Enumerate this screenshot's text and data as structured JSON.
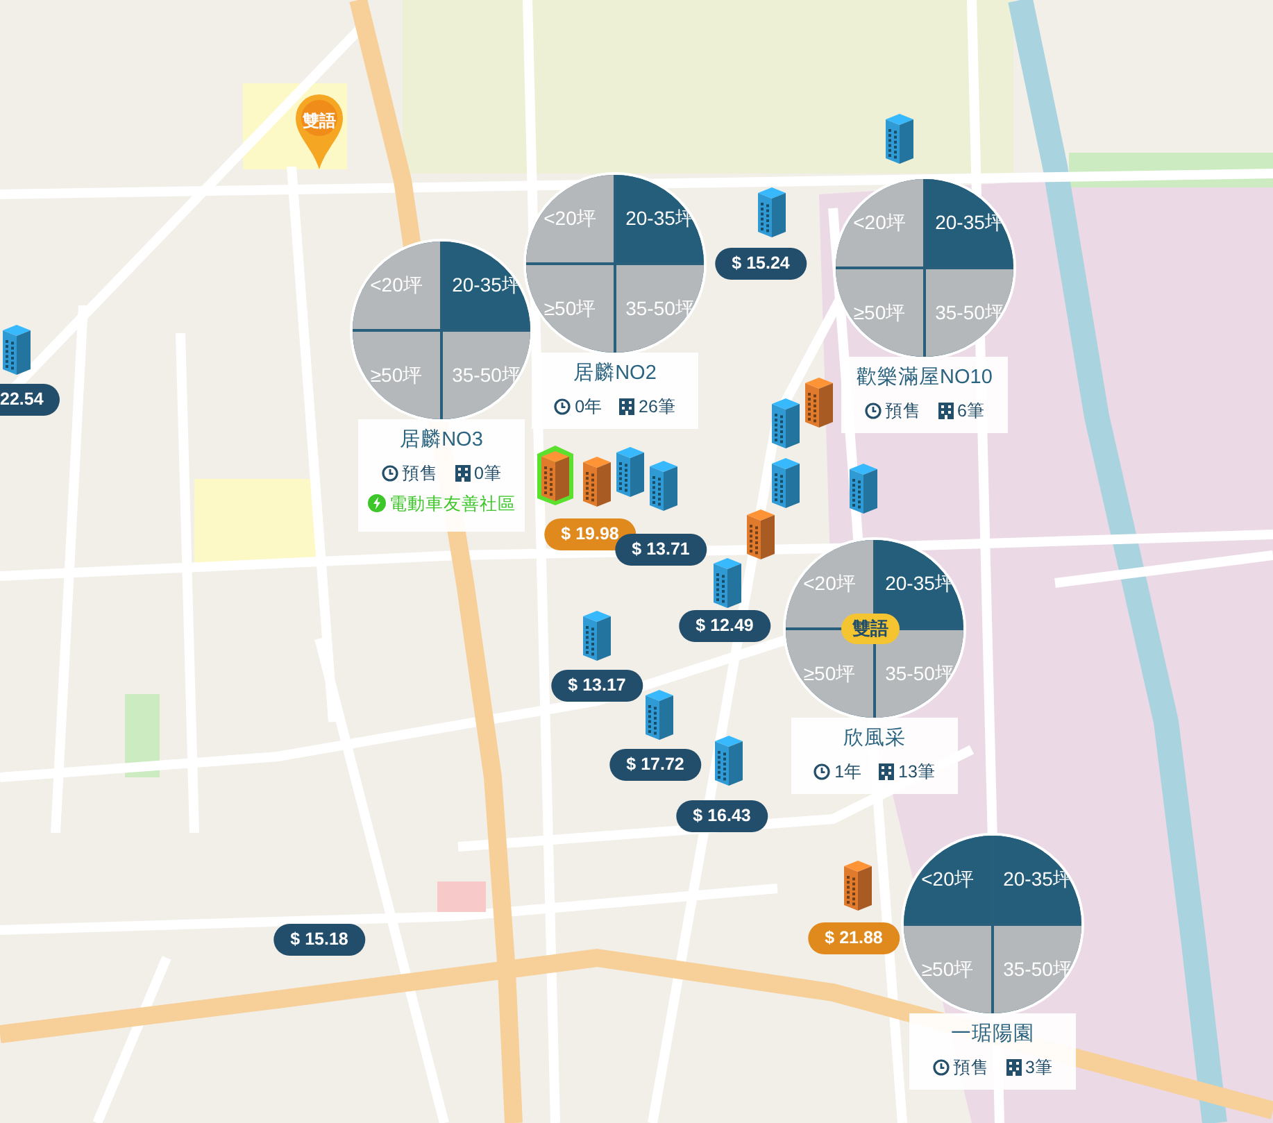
{
  "map": {
    "school_pin": {
      "label": "雙語"
    },
    "buildings": [
      {
        "color": "#2f9ad3",
        "highlighted": false
      },
      {
        "color": "#2f9ad3",
        "highlighted": false
      },
      {
        "color": "#2f9ad3",
        "highlighted": false
      },
      {
        "color": "#2f9ad3",
        "highlighted": false
      },
      {
        "color": "#e07b2e",
        "highlighted": true
      },
      {
        "color": "#e07b2e",
        "highlighted": false
      },
      {
        "color": "#2f9ad3",
        "highlighted": false
      },
      {
        "color": "#2f9ad3",
        "highlighted": false
      },
      {
        "color": "#e07b2e",
        "highlighted": false
      },
      {
        "color": "#2f9ad3",
        "highlighted": false
      },
      {
        "color": "#2f9ad3",
        "highlighted": false
      },
      {
        "color": "#e07b2e",
        "highlighted": false
      },
      {
        "color": "#2f9ad3",
        "highlighted": false
      },
      {
        "color": "#2f9ad3",
        "highlighted": false
      },
      {
        "color": "#2f9ad3",
        "highlighted": false
      },
      {
        "color": "#2f9ad3",
        "highlighted": false
      },
      {
        "color": "#e07b2e",
        "highlighted": false
      }
    ],
    "price_tags": [
      {
        "label": "22.54",
        "color": "#234e6b"
      },
      {
        "label": "$ 15.24",
        "color": "#234e6b"
      },
      {
        "label": "$ 19.98",
        "color": "#e08a1e"
      },
      {
        "label": "$ 13.71",
        "color": "#234e6b"
      },
      {
        "label": "$ 12.49",
        "color": "#234e6b"
      },
      {
        "label": "$ 13.17",
        "color": "#234e6b"
      },
      {
        "label": "$ 17.72",
        "color": "#234e6b"
      },
      {
        "label": "$ 16.43",
        "color": "#234e6b"
      },
      {
        "label": "$ 15.18",
        "color": "#234e6b"
      },
      {
        "label": "$ 21.88",
        "color": "#e08a1e"
      }
    ],
    "clusters": [
      {
        "segments": [
          {
            "label": "<20坪",
            "highlighted": false
          },
          {
            "label": "20-35坪",
            "highlighted": true
          },
          {
            "label": "≥50坪",
            "highlighted": false
          },
          {
            "label": "35-50坪",
            "highlighted": false
          }
        ],
        "name": "居麟NO3",
        "age": "預售",
        "count": "0筆",
        "ev_tag": "電動車友善社區"
      },
      {
        "segments": [
          {
            "label": "<20坪",
            "highlighted": false
          },
          {
            "label": "20-35坪",
            "highlighted": true
          },
          {
            "label": "≥50坪",
            "highlighted": false
          },
          {
            "label": "35-50坪",
            "highlighted": false
          }
        ],
        "name": "居麟NO2",
        "age": "0年",
        "count": "26筆"
      },
      {
        "segments": [
          {
            "label": "<20坪",
            "highlighted": false
          },
          {
            "label": "20-35坪",
            "highlighted": true
          },
          {
            "label": "≥50坪",
            "highlighted": false
          },
          {
            "label": "35-50坪",
            "highlighted": false
          }
        ],
        "name": "歡樂滿屋NO10",
        "age": "預售",
        "count": "6筆"
      },
      {
        "segments": [
          {
            "label": "<20坪",
            "highlighted": false
          },
          {
            "label": "20-35坪",
            "highlighted": true
          },
          {
            "label": "≥50坪",
            "highlighted": false
          },
          {
            "label": "35-50坪",
            "highlighted": false
          }
        ],
        "badge": "雙語",
        "name": "欣風采",
        "age": "1年",
        "count": "13筆"
      },
      {
        "segments": [
          {
            "label": "<20坪",
            "highlighted": true
          },
          {
            "label": "20-35坪",
            "highlighted": true
          },
          {
            "label": "≥50坪",
            "highlighted": false
          },
          {
            "label": "35-50坪",
            "highlighted": false
          }
        ],
        "name": "一琚陽園",
        "age": "預售",
        "count": "3筆"
      }
    ]
  }
}
